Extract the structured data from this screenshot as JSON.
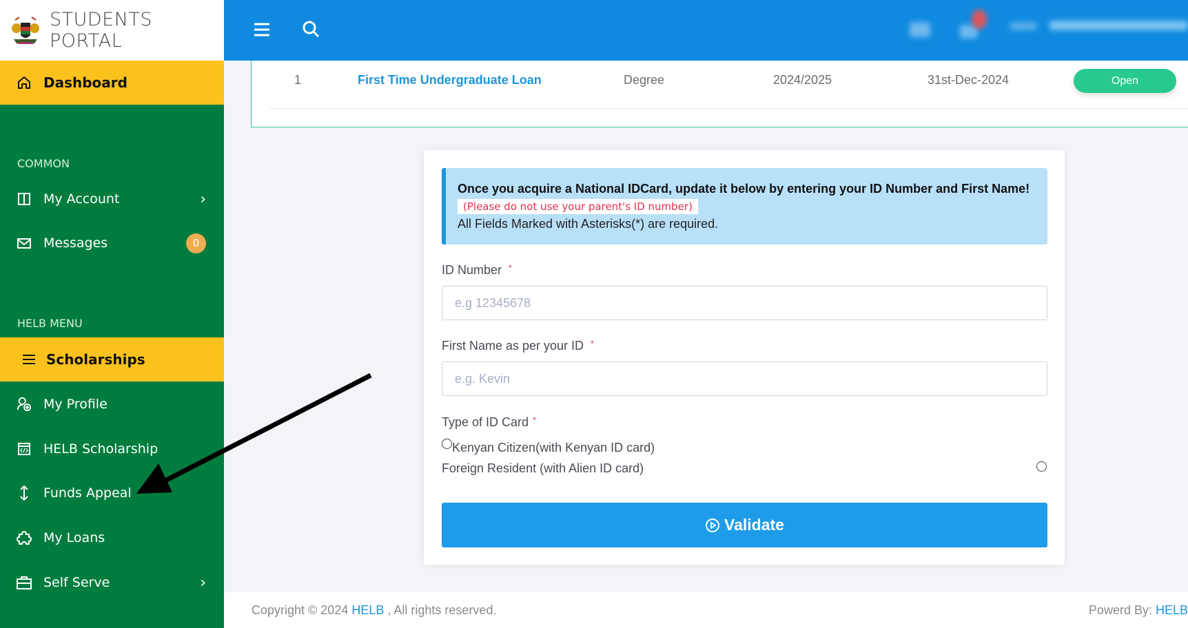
{
  "brand": {
    "title": "STUDENTS PORTAL",
    "logo_icon": "kenya-coat-of-arms-icon"
  },
  "sidebar": {
    "dashboard": {
      "label": "Dashboard",
      "icon": "home-icon"
    },
    "sections": [
      {
        "label": "COMMON"
      },
      {
        "label": "HELB MENU"
      }
    ],
    "common_items": [
      {
        "label": "My Account",
        "icon": "columns-icon",
        "has_chevron": true
      },
      {
        "label": "Messages",
        "icon": "envelope-icon",
        "badge": "0"
      }
    ],
    "helb_active": {
      "label": "Scholarships",
      "icon": "menu-icon"
    },
    "helb_items": [
      {
        "label": "My Profile",
        "icon": "user-plus-icon"
      },
      {
        "label": "HELB Scholarship",
        "icon": "code-window-icon"
      },
      {
        "label": "Funds Appeal",
        "icon": "up-down-arrow-icon"
      },
      {
        "label": "My Loans",
        "icon": "puzzle-icon"
      },
      {
        "label": "Self Serve",
        "icon": "briefcase-icon",
        "has_chevron": true
      }
    ]
  },
  "topbar": {
    "menu_icon": "hamburger-icon",
    "search_icon": "search-icon"
  },
  "table": {
    "rows": [
      {
        "index": "1",
        "name": "First Time Undergraduate Loan",
        "level": "Degree",
        "year": "2024/2025",
        "deadline": "31st-Dec-2024",
        "status": "Open"
      }
    ]
  },
  "form": {
    "alert": {
      "line1": "Once you acquire a National IDCard, update it below by entering your ID Number and First Name!",
      "warning": "(Please do not use your parent's ID number)",
      "note": "All Fields Marked with Asterisks(*) are required."
    },
    "id_number": {
      "label": "ID Number",
      "required": "*",
      "placeholder": "e.g 12345678",
      "value": ""
    },
    "first_name": {
      "label": "First Name as per your ID",
      "required": "*",
      "placeholder": "e.g. Kevin",
      "value": ""
    },
    "id_type": {
      "label": "Type of ID Card",
      "required": "*",
      "options": [
        {
          "label": "Kenyan Citizen(with Kenyan ID card)",
          "checked": false
        },
        {
          "label": "Foreign Resident (with Alien ID card)",
          "checked": false
        }
      ]
    },
    "submit": {
      "label": "Validate",
      "icon": "play-circle-icon"
    }
  },
  "footer": {
    "copyright_prefix": "Copyright © 2024 ",
    "copyright_link": "HELB",
    "copyright_suffix": " , All rights reserved.",
    "powered_prefix": "Powerd By: ",
    "powered_link": "HELB I"
  },
  "colors": {
    "sidebar_green": "#017c3f",
    "active_yellow": "#fbc21e",
    "topbar_blue": "#0f8ae0",
    "open_green": "#27c98e",
    "badge_orange": "#f0ad4e",
    "alert_blue": "#b8e0f9"
  }
}
